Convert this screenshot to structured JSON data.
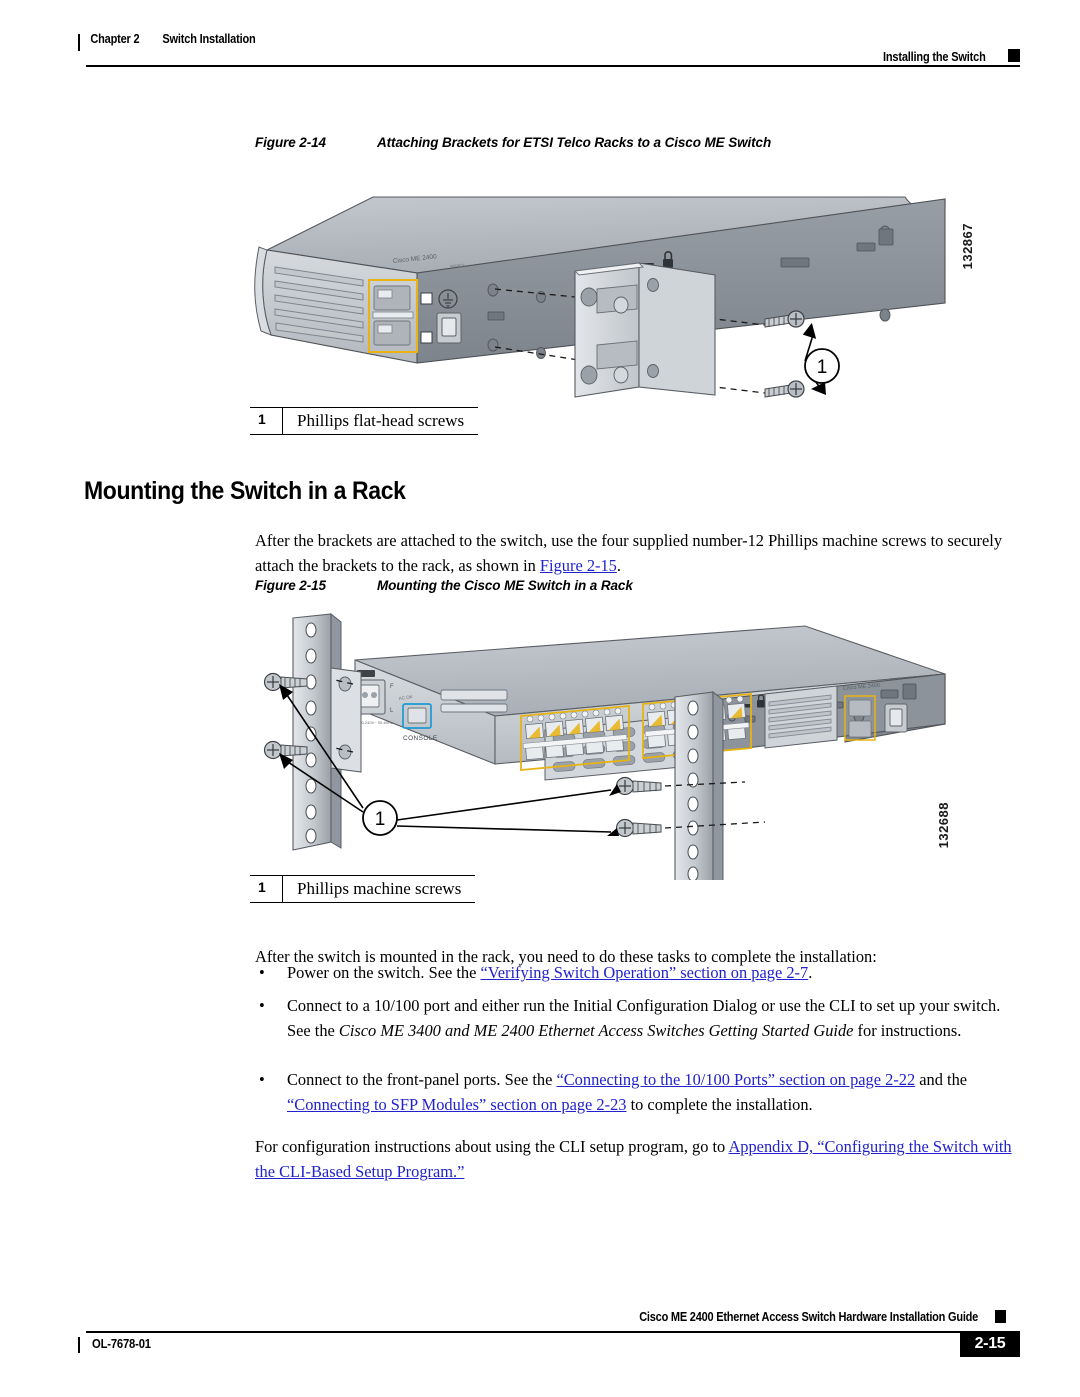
{
  "header": {
    "chapter": "Chapter 2",
    "chapter_title": "Switch Installation",
    "right_title": "Installing the Switch"
  },
  "figure_214": {
    "number": "Figure 2-14",
    "title": "Attaching Brackets for ETSI Telco Racks to a Cisco ME Switch",
    "art_id": "132867",
    "device_label": "Cisco ME 2400 SERIES",
    "callout_number": "1",
    "legend": {
      "num": "1",
      "text": "Phillips flat-head screws"
    }
  },
  "section": {
    "heading": "Mounting the Switch in a Rack",
    "intro_part1": "After the brackets are attached to the switch, use the four supplied number-12 Phillips machine screws to securely attach the brackets to the rack, as shown in ",
    "intro_link": "Figure 2-15",
    "intro_part2": "."
  },
  "figure_215": {
    "number": "Figure 2-15",
    "title": "Mounting the Cisco ME Switch in a Rack",
    "art_id": "132688",
    "console_label": "CONSOLE",
    "device_label": "Cisco ME 2400 SERIES",
    "callout_number": "1",
    "legend": {
      "num": "1",
      "text": "Phillips machine screws"
    }
  },
  "tasks": {
    "intro": "After the switch is mounted in the rack, you need to do these tasks to complete the installation:",
    "bullet1_pre": "Power on the switch. See the ",
    "bullet1_link": "“Verifying Switch Operation” section on page 2-7",
    "bullet1_post": ".",
    "bullet2_pre": "Connect to a 10/100 port and either run the Initial Configuration Dialog or use the CLI to set up your switch. See the ",
    "bullet2_italic": "Cisco ME 3400 and ME 2400 Ethernet Access Switches Getting Started Guide",
    "bullet2_post": " for instructions.",
    "bullet3_pre": "Connect to the front-panel ports. See the ",
    "bullet3_link1": "“Connecting to the 10/100 Ports” section on page 2-22",
    "bullet3_mid": " and the ",
    "bullet3_link2": "“Connecting to SFP Modules” section on page 2-23",
    "bullet3_post": " to complete the installation.",
    "closing_pre": "For configuration instructions about using the CLI setup program, go to ",
    "closing_link": "Appendix D, “Configuring the Switch with the CLI-Based Setup Program.”"
  },
  "footer": {
    "doc_id": "OL-7678-01",
    "guide_title": "Cisco ME 2400 Ethernet Access Switch Hardware Installation Guide",
    "page_number": "2-15"
  },
  "colors": {
    "link": "#2222cc",
    "chassis_top": "#b9bec4",
    "chassis_face": "#8e949b",
    "chassis_front": "#c9cdd2",
    "port_highlight": "#e8b313",
    "console_highlight": "#1b9ad6"
  }
}
